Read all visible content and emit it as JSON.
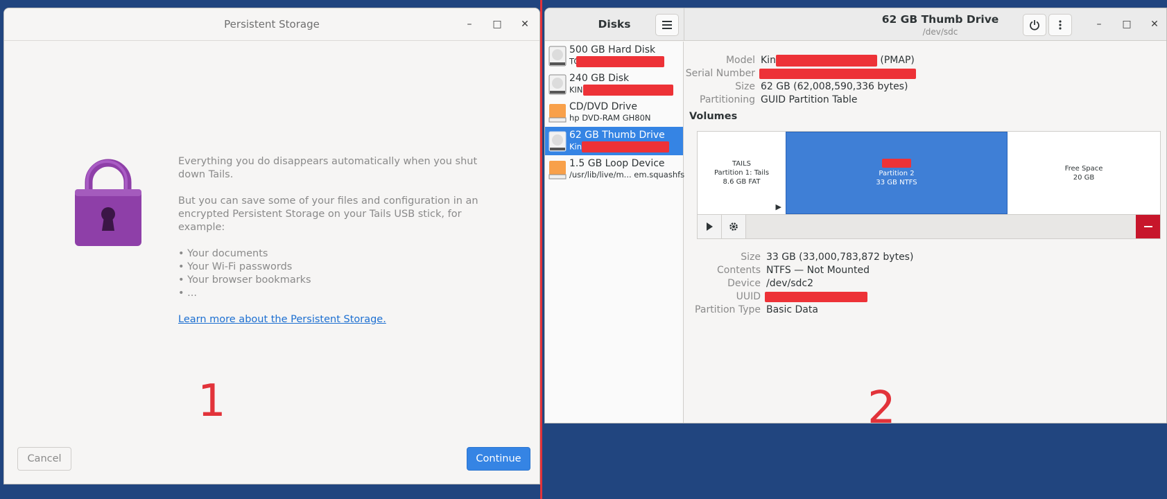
{
  "win1": {
    "title": "Persistent Storage",
    "controls": {
      "minimize": "–",
      "maximize": "□",
      "close": "✕"
    },
    "para1": "Everything you do disappears automatically when you shut down Tails.",
    "para2": "But you can save some of your files and configuration in an encrypted Persistent Storage on your Tails USB stick, for example:",
    "bullets": [
      "• Your documents",
      "• Your Wi-Fi passwords",
      "• Your browser bookmarks",
      "• ..."
    ],
    "link": "Learn more about the Persistent Storage.",
    "cancel": "Cancel",
    "continue": "Continue",
    "marker": "1",
    "lock_color": "#8e3fa8"
  },
  "win2": {
    "sidebar_title": "Disks",
    "title": "62 GB Thumb Drive",
    "subtitle": "/dev/sdc",
    "marker": "2",
    "drives": [
      {
        "name": "500 GB Hard Disk",
        "sub_prefix": "TC",
        "icon": "hard-disk-icon"
      },
      {
        "name": "240 GB Disk",
        "sub_prefix": "KIN",
        "icon": "hard-disk-icon"
      },
      {
        "name": "CD/DVD Drive",
        "sub": "hp     DVD-RAM GH80N",
        "icon": "optical-drive-icon"
      },
      {
        "name": "62 GB Thumb Drive",
        "sub_prefix": "Kin",
        "icon": "usb-drive-icon"
      },
      {
        "name": "1.5 GB Loop Device",
        "sub": "/usr/lib/live/m... em.squashfs",
        "icon": "loop-device-icon"
      }
    ],
    "info": {
      "model_label": "Model",
      "model_prefix": "Kin",
      "model_suffix": "(PMAP)",
      "serial_label": "Serial Number",
      "size_label": "Size",
      "size": "62 GB (62,008,590,336 bytes)",
      "partitioning_label": "Partitioning",
      "partitioning": "GUID Partition Table"
    },
    "volumes_label": "Volumes",
    "partitions": [
      {
        "name": "TAILS",
        "line2": "Partition 1: Tails",
        "line3": "8.6 GB FAT"
      },
      {
        "name": "",
        "line2": "Partition 2",
        "line3": "33 GB NTFS"
      },
      {
        "name": "Free Space",
        "line2": "20 GB"
      }
    ],
    "details": {
      "size_label": "Size",
      "size": "33 GB (33,000,783,872 bytes)",
      "contents_label": "Contents",
      "contents": "NTFS — Not Mounted",
      "device_label": "Device",
      "device": "/dev/sdc2",
      "uuid_label": "UUID",
      "ptype_label": "Partition Type",
      "ptype": "Basic Data"
    }
  }
}
